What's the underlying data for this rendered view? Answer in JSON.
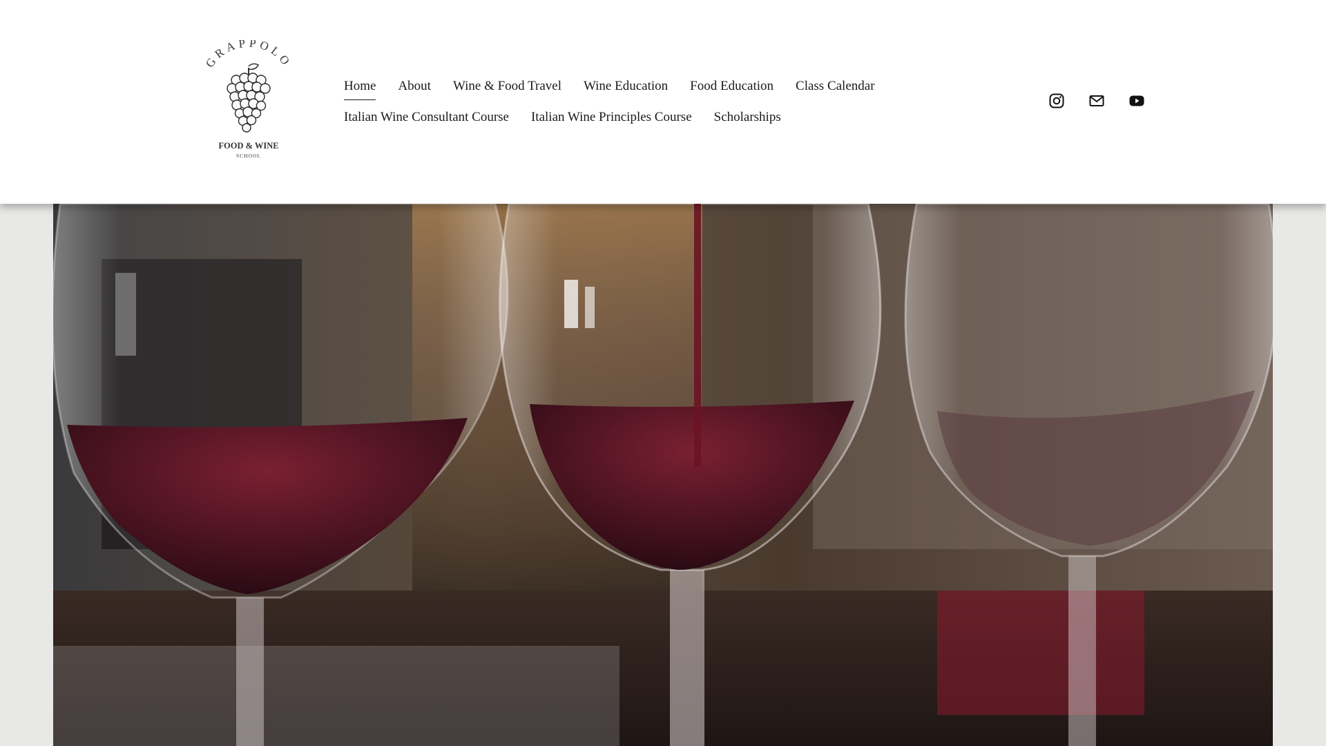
{
  "logo": {
    "arc_text": "GRAPPOLO",
    "line1": "FOOD & WINE",
    "line2": "SCHOOL",
    "icon": "grape-cluster-icon"
  },
  "nav": {
    "row1": [
      {
        "label": "Home",
        "active": true
      },
      {
        "label": "About"
      },
      {
        "label": "Wine & Food Travel"
      },
      {
        "label": "Wine Education"
      },
      {
        "label": "Food Education"
      },
      {
        "label": "Class Calendar"
      }
    ],
    "row2": [
      {
        "label": "Italian Wine Consultant Course"
      },
      {
        "label": "Italian Wine Principles Course"
      },
      {
        "label": "Scholarships"
      }
    ]
  },
  "social": [
    {
      "icon": "instagram-icon"
    },
    {
      "icon": "email-icon"
    },
    {
      "icon": "youtube-icon"
    }
  ],
  "hero": {
    "image": "red-wine-pouring-into-glasses"
  },
  "colors": {
    "header_bg": "#ffffff",
    "page_bg": "#e8e8e6",
    "text": "#1a1a1a",
    "wine": "#5a1522"
  }
}
